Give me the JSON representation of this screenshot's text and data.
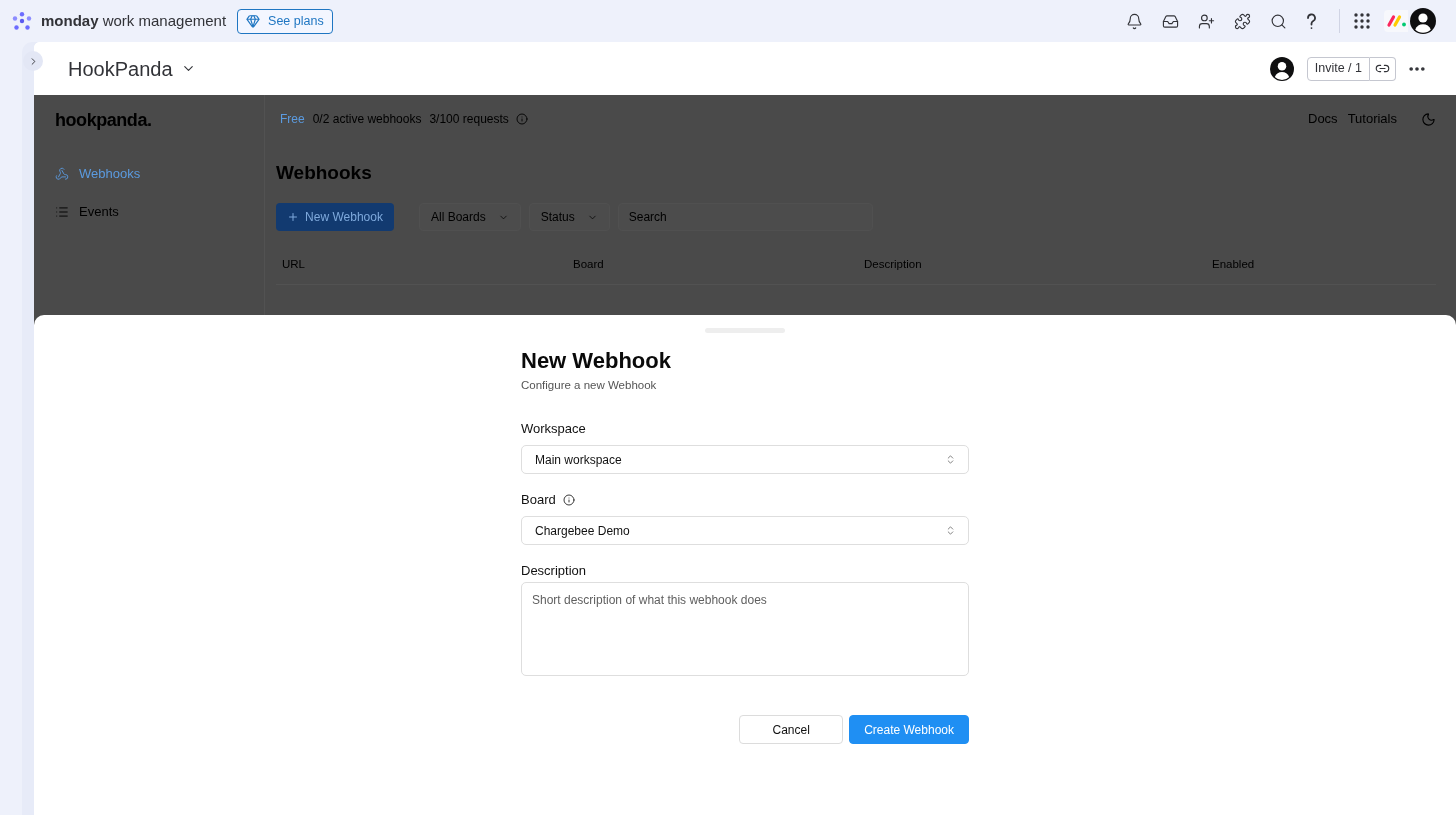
{
  "top_bar": {
    "brand": "**monday** work management",
    "plans_button": "See plans"
  },
  "board_header": {
    "title": "HookPanda",
    "invite_button": "Invite / 1"
  },
  "app": {
    "logo": "hookpanda.",
    "usage": {
      "plan": "Free",
      "webhooks": "0/2 active webhooks",
      "requests": "3/100 requests"
    },
    "links": [
      "Docs",
      "Tutorials"
    ],
    "sidebar": {
      "items": [
        {
          "kind": "webhooks",
          "label": "Webhooks",
          "selected": true
        },
        {
          "kind": "events",
          "label": "Events",
          "selected": false
        }
      ]
    },
    "page_title": "Webhooks",
    "new_button": "New Webhook",
    "filters": [
      "All Boards",
      "Status"
    ],
    "search": {
      "placeholder": "Search"
    },
    "table": {
      "columns": [
        "URL",
        "Board",
        "Description",
        "Enabled"
      ]
    }
  },
  "dialog": {
    "title": "New Webhook",
    "subtitle": "Configure a new Webhook",
    "fields": [
      {
        "kind": "select",
        "label": "Workspace",
        "value": "Main workspace"
      },
      {
        "kind": "select",
        "label": "Board",
        "info": true,
        "value": "Chargebee Demo"
      },
      {
        "kind": "textarea",
        "label": "Description",
        "placeholder": "Short description of what this webhook does"
      }
    ],
    "buttons": [
      {
        "kind": "secondary",
        "label": "Cancel"
      },
      {
        "kind": "primary",
        "label": "Create Webhook"
      }
    ]
  }
}
